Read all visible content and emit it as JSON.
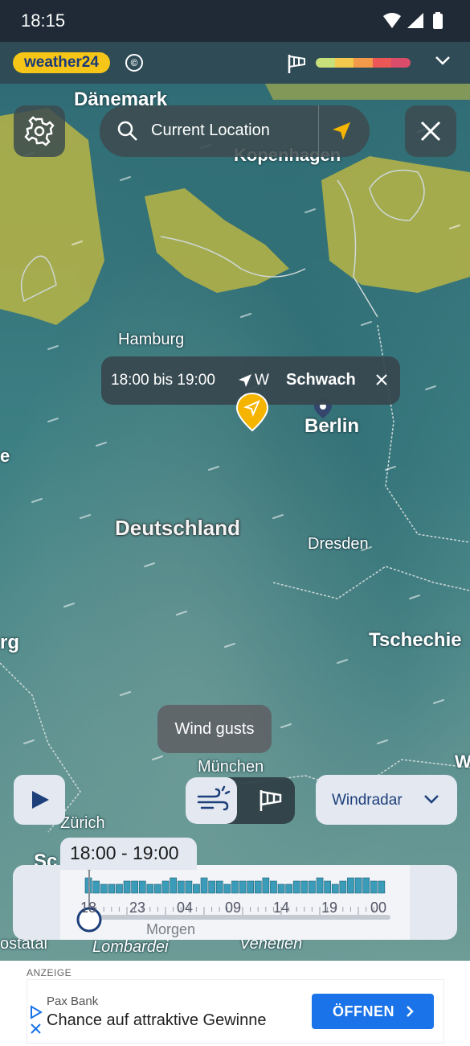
{
  "status_bar": {
    "time": "18:15"
  },
  "header": {
    "logo_text": "weather24",
    "copyright_symbol": "©"
  },
  "legend": {
    "colors": [
      "#c8e07a",
      "#f2c94c",
      "#f2994a",
      "#eb5757",
      "#d94c6a"
    ]
  },
  "search": {
    "placeholder": "Current Location"
  },
  "map_labels": {
    "daenemark": "Dänemark",
    "kopenhagen": "Kopenhagen",
    "hamburg": "Hamburg",
    "berlin": "Berlin",
    "deutschland": "Deutschland",
    "dresden": "Dresden",
    "tschechien": "Tschechie",
    "rg": "rg",
    "muenchen": "München",
    "zuerich": "Zürich",
    "sc": "Sc",
    "ostatal": "ostatal",
    "lombardei": "Lombardei",
    "venetien": "Venetien",
    "w": "W",
    "e": "e"
  },
  "popup": {
    "time_range": "18:00 bis 19:00",
    "direction": "W",
    "strength": "Schwach"
  },
  "tooltip": {
    "text": "Wind gusts"
  },
  "layer_dropdown": {
    "label": "Windradar"
  },
  "timeline": {
    "selected_range": "18:00 - 19:00",
    "tick_labels": [
      "18",
      "23",
      "04",
      "09",
      "14",
      "19",
      "00"
    ],
    "day_label": "Morgen",
    "bars": [
      3,
      2,
      1,
      1,
      1,
      2,
      2,
      2,
      1,
      1,
      2,
      3,
      2,
      2,
      1,
      3,
      2,
      2,
      1,
      2,
      2,
      2,
      2,
      3,
      2,
      1,
      1,
      2,
      2,
      2,
      3,
      2,
      1,
      2,
      3,
      3,
      3,
      2,
      2
    ]
  },
  "ad": {
    "tag": "ANZEIGE",
    "advertiser": "Pax Bank",
    "headline": "Chance auf attraktive Gewinne",
    "button_label": "ÖFFNEN"
  }
}
